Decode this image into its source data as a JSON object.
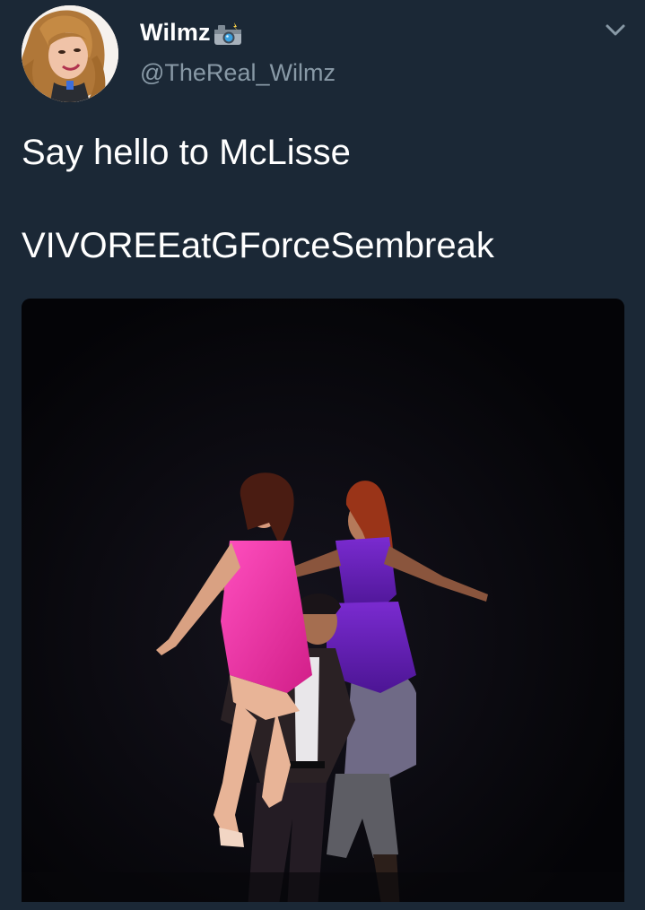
{
  "tweet": {
    "author": {
      "display_name": "Wilmz",
      "name_emoji": "camera-with-flash-icon",
      "handle": "@TheReal_Wilmz",
      "avatar": "user-avatar-photo"
    },
    "menu_icon": "chevron-down-icon",
    "text_lines": [
      "Say hello to McLisse",
      "VIVOREEatGForceSembreak"
    ],
    "media": {
      "kind": "photo",
      "subject": "dancers-on-stage"
    }
  },
  "colors": {
    "background": "#1b2836",
    "primary_text": "#ffffff",
    "secondary_text": "#8899a6",
    "pink_dress": "#ea2f9e",
    "purple_dress": "#6a1fb5"
  }
}
